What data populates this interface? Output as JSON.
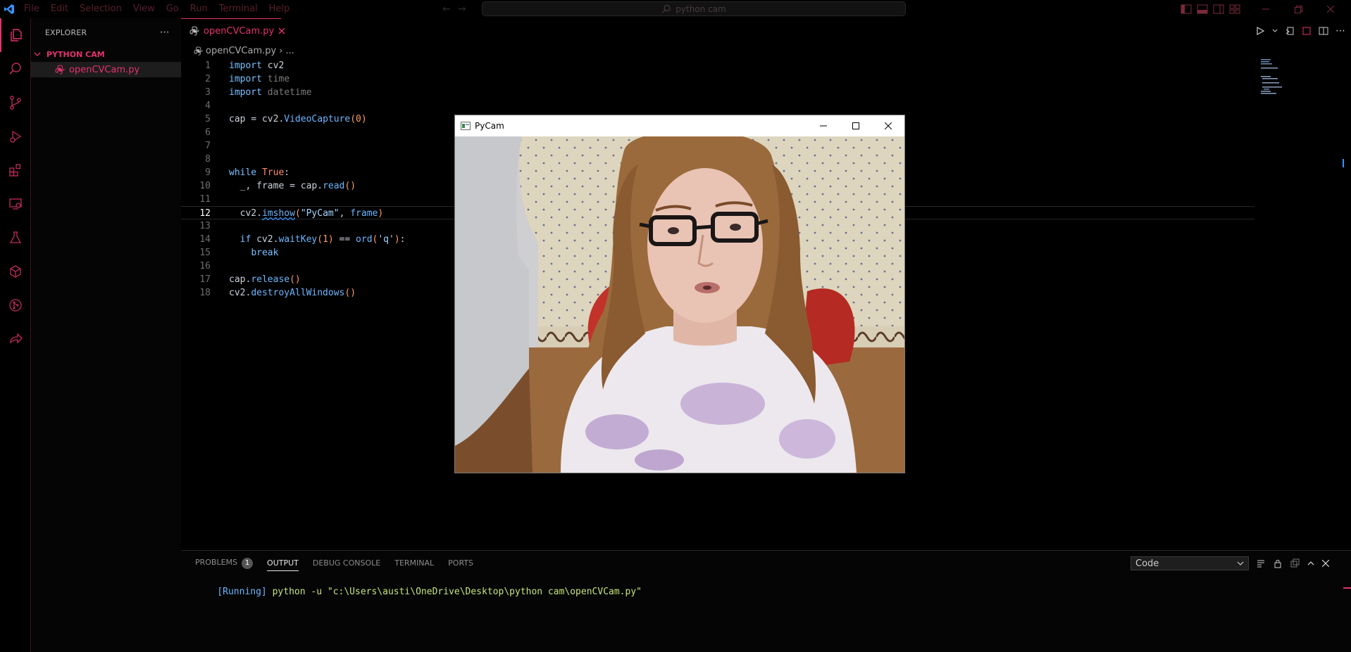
{
  "titlebar": {
    "menu": [
      "File",
      "Edit",
      "Selection",
      "View",
      "Go",
      "Run",
      "Terminal",
      "Help"
    ],
    "search_text": "python cam"
  },
  "activity_icons": [
    "explorer-icon",
    "search-icon",
    "source-control-icon",
    "run-debug-icon",
    "extensions-icon",
    "remote-explorer-icon",
    "testing-icon",
    "container-icon",
    "git-graph-icon",
    "live-share-icon"
  ],
  "sidebar": {
    "title": "EXPLORER",
    "folder": "PYTHON CAM",
    "file": "openCVCam.py"
  },
  "editor": {
    "tab_label": "openCVCam.py",
    "breadcrumb_file": "openCVCam.py",
    "breadcrumb_more": "...",
    "current_line": 12
  },
  "camera_window": {
    "title": "PyCam"
  },
  "panel": {
    "tabs": [
      "PROBLEMS",
      "OUTPUT",
      "DEBUG CONSOLE",
      "TERMINAL",
      "PORTS"
    ],
    "active_tab": "OUTPUT",
    "problems_count": "1",
    "output_channel": "Code",
    "output_running": "[Running]",
    "output_command": "python -u \"c:\\Users\\austi\\OneDrive\\Desktop\\python cam\\openCVCam.py\""
  },
  "colors": {
    "accent": "#e3326f",
    "background": "#000000"
  }
}
